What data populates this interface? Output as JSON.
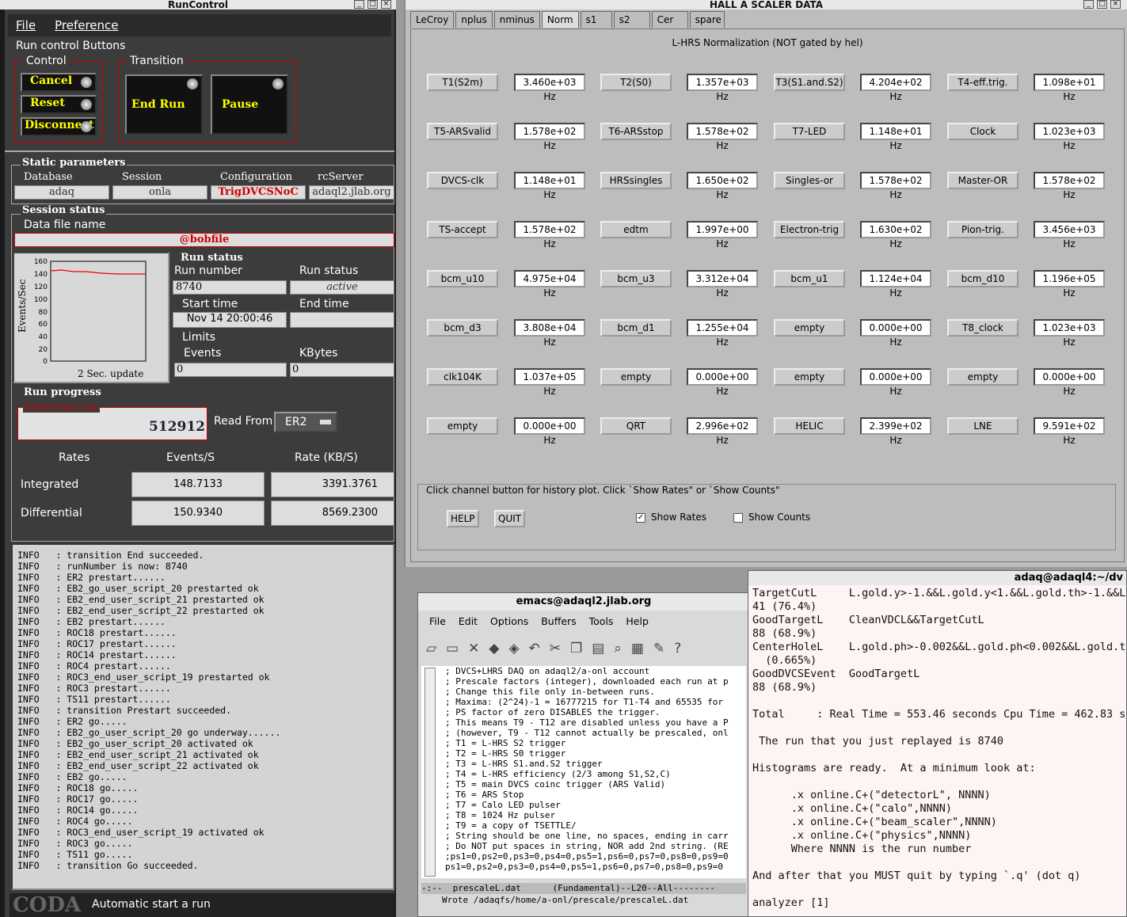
{
  "runcontrol": {
    "title": "RunControl",
    "menu": [
      "File",
      "Preference"
    ],
    "buttons_title": "Run control Buttons",
    "control_label": "Control",
    "transition_label": "Transition",
    "cancel": "Cancel",
    "reset": "Reset",
    "disconnect": "Disconnect",
    "end_run": "End Run",
    "pause": "Pause",
    "static_title": "Static parameters",
    "static_labels": [
      "Database",
      "Session",
      "Configuration",
      "rcServer"
    ],
    "static_values": [
      "adaq",
      "onla",
      "TrigDVCSNoC",
      "adaql2.jlab.org"
    ],
    "session_status": "Session status",
    "data_file_label": "Data file name",
    "data_file": "@bobfile",
    "chart_ylabel": "Events/Sec",
    "chart_caption": "2 Sec. update",
    "chart_ticks": [
      "160",
      "140",
      "120",
      "100",
      "80",
      "60",
      "40",
      "20",
      "0"
    ],
    "run_status_title": "Run status",
    "run_number_label": "Run number",
    "run_number": "8740",
    "run_status_label": "Run status",
    "run_status": "active",
    "start_time_label": "Start time",
    "start_time": "Nov 14 20:00:46",
    "end_time_label": "End time",
    "end_time": "",
    "limits_label": "Limits",
    "events_label": "Events",
    "events_value": "0",
    "kbytes_label": "KBytes",
    "kbytes_value": "0",
    "run_progress": "Run progress",
    "events_this_run_label": "Events this run",
    "events_this_run": "512912",
    "read_from_label": "Read From:",
    "read_from": "ER2",
    "rates_headers": [
      "Rates",
      "Events/S",
      "Rate (KB/S)"
    ],
    "integrated_label": "Integrated",
    "integrated_evs": "148.7133",
    "integrated_kbs": "3391.3761",
    "differential_label": "Differential",
    "differential_evs": "150.9340",
    "differential_kbs": "8569.2300",
    "log": "INFO   : transition End succeeded.\nINFO   : runNumber is now: 8740\nINFO   : ER2 prestart......\nINFO   : EB2_go_user_script_20 prestarted ok\nINFO   : EB2_end_user_script_21 prestarted ok\nINFO   : EB2_end_user_script_22 prestarted ok\nINFO   : EB2 prestart......\nINFO   : ROC18 prestart......\nINFO   : ROC17 prestart......\nINFO   : ROC14 prestart......\nINFO   : ROC4 prestart......\nINFO   : ROC3_end_user_script_19 prestarted ok\nINFO   : ROC3 prestart......\nINFO   : TS11 prestart......\nINFO   : transition Prestart succeeded.\nINFO   : ER2 go.....\nINFO   : EB2_go_user_script_20 go underway......\nINFO   : EB2_go_user_script_20 activated ok\nINFO   : EB2_end_user_script_21 activated ok\nINFO   : EB2_end_user_script_22 activated ok\nINFO   : EB2 go.....\nINFO   : ROC18 go.....\nINFO   : ROC17 go.....\nINFO   : ROC14 go.....\nINFO   : ROC4 go.....\nINFO   : ROC3_end_user_script_19 activated ok\nINFO   : ROC3 go.....\nINFO   : TS11 go.....\nINFO   : transition Go succeeded.",
    "coda_logo": "CODA",
    "status_text": "Automatic start a run"
  },
  "scaler": {
    "title": "HALL  A  SCALER  DATA",
    "tabs": [
      "LeCroy",
      "nplus",
      "nminus",
      "Norm",
      "s1",
      "s2",
      "Cer",
      "spare"
    ],
    "heading": "L-HRS Normalization (NOT gated by hel)",
    "rows": [
      [
        [
          "T1(S2m)",
          "3.460e+03 Hz"
        ],
        [
          "T2(S0)",
          "1.357e+03 Hz"
        ],
        [
          "T3(S1.and.S2)",
          "4.204e+02 Hz"
        ],
        [
          "T4-eff.trig.",
          "1.098e+01 Hz"
        ]
      ],
      [
        [
          "T5-ARSvalid",
          "1.578e+02 Hz"
        ],
        [
          "T6-ARSstop",
          "1.578e+02 Hz"
        ],
        [
          "T7-LED",
          "1.148e+01 Hz"
        ],
        [
          "Clock",
          "1.023e+03 Hz"
        ]
      ],
      [
        [
          "DVCS-clk",
          "1.148e+01 Hz"
        ],
        [
          "HRSsingles",
          "1.650e+02 Hz"
        ],
        [
          "Singles-or",
          "1.578e+02 Hz"
        ],
        [
          "Master-OR",
          "1.578e+02 Hz"
        ]
      ],
      [
        [
          "TS-accept",
          "1.578e+02 Hz"
        ],
        [
          "edtm",
          "1.997e+00 Hz"
        ],
        [
          "Electron-trig",
          "1.630e+02 Hz"
        ],
        [
          "Pion-trig.",
          "3.456e+03 Hz"
        ]
      ],
      [
        [
          "bcm_u10",
          "4.975e+04 Hz"
        ],
        [
          "bcm_u3",
          "3.312e+04 Hz"
        ],
        [
          "bcm_u1",
          "1.124e+04 Hz"
        ],
        [
          "bcm_d10",
          "1.196e+05 Hz"
        ]
      ],
      [
        [
          "bcm_d3",
          "3.808e+04 Hz"
        ],
        [
          "bcm_d1",
          "1.255e+04 Hz"
        ],
        [
          "empty",
          "0.000e+00 Hz"
        ],
        [
          "T8_clock",
          "1.023e+03 Hz"
        ]
      ],
      [
        [
          "clk104K",
          "1.037e+05 Hz"
        ],
        [
          "empty",
          "0.000e+00 Hz"
        ],
        [
          "empty",
          "0.000e+00 Hz"
        ],
        [
          "empty",
          "0.000e+00 Hz"
        ]
      ],
      [
        [
          "empty",
          "0.000e+00 Hz"
        ],
        [
          "QRT",
          "2.996e+02 Hz"
        ],
        [
          "HELIC",
          "2.399e+02 Hz"
        ],
        [
          "LNE",
          "9.591e+02 Hz"
        ]
      ]
    ],
    "hint": "Click channel button for history plot.  Click `Show Rates\" or `Show Counts\"",
    "help": "HELP",
    "quit": "QUIT",
    "show_rates": "Show Rates",
    "show_counts": "Show Counts"
  },
  "emacs": {
    "title": "emacs@adaql2.jlab.org",
    "menu": [
      "File",
      "Edit",
      "Options",
      "Buffers",
      "Tools",
      "Help"
    ],
    "buffer": "; DVCS+LHRS DAQ on adaql2/a-onl account\n; Prescale factors (integer), downloaded each run at p\n; Change this file only in-between runs.\n; Maxima: (2^24)-1 = 16777215 for T1-T4 and 65535 for\n; PS factor of zero DISABLES the trigger.\n; This means T9 - T12 are disabled unless you have a P\n; (however, T9 - T12 cannot actually be prescaled, onl\n; T1 = L-HRS S2 trigger\n; T2 = L-HRS S0 trigger\n; T3 = L-HRS S1.and.S2 trigger\n; T4 = L-HRS efficiency (2/3 among S1,S2,C)\n; T5 = main DVCS coinc trigger (ARS Valid)\n; T6 = ARS Stop\n; T7 = Calo LED pulser\n; T8 = 1024 Hz pulser\n; T9 = a copy of TSETTLE/\n; String should be one line, no spaces, ending in carr\n; Do NOT put spaces in string, NOR add 2nd string. (RE\n;ps1=0,ps2=0,ps3=0,ps4=0,ps5=1,ps6=0,ps7=0,ps8=0,ps9=0\nps1=0,ps2=0,ps3=0,ps4=0,ps5=1,ps6=0,ps7=0,ps8=0,ps9=0",
    "modeline": "-:--  prescaleL.dat      (Fundamental)--L20--All--------",
    "echo": "Wrote /adaqfs/home/a-onl/prescale/prescaleL.dat"
  },
  "terminal": {
    "title": "adaq@adaql4:~/dv",
    "text": "TargetCutL     L.gold.y>-1.&&L.gold.y<1.&&L.gold.th>-1.&&L.\n41 (76.4%)\nGoodTargetL    CleanVDCL&&TargetCutL\n88 (68.9%)\nCenterHoleL    L.gold.ph>-0.002&&L.gold.ph<0.002&&L.gold.th\n  (0.665%)\nGoodDVCSEvent  GoodTargetL\n88 (68.9%)\n\nTotal     : Real Time = 553.46 seconds Cpu Time = 462.83 sec\n\n The run that you just replayed is 8740\n\nHistograms are ready.  At a minimum look at:\n\n      .x online.C+(\"detectorL\", NNNN)\n      .x online.C+(\"calo\",NNNN)\n      .x online.C+(\"beam_scaler\",NNNN)\n      .x online.C+(\"physics\",NNNN)\n      Where NNNN is the run number\n\nAnd after that you MUST quit by typing `.q' (dot q)\n\nanalyzer [1] "
  }
}
